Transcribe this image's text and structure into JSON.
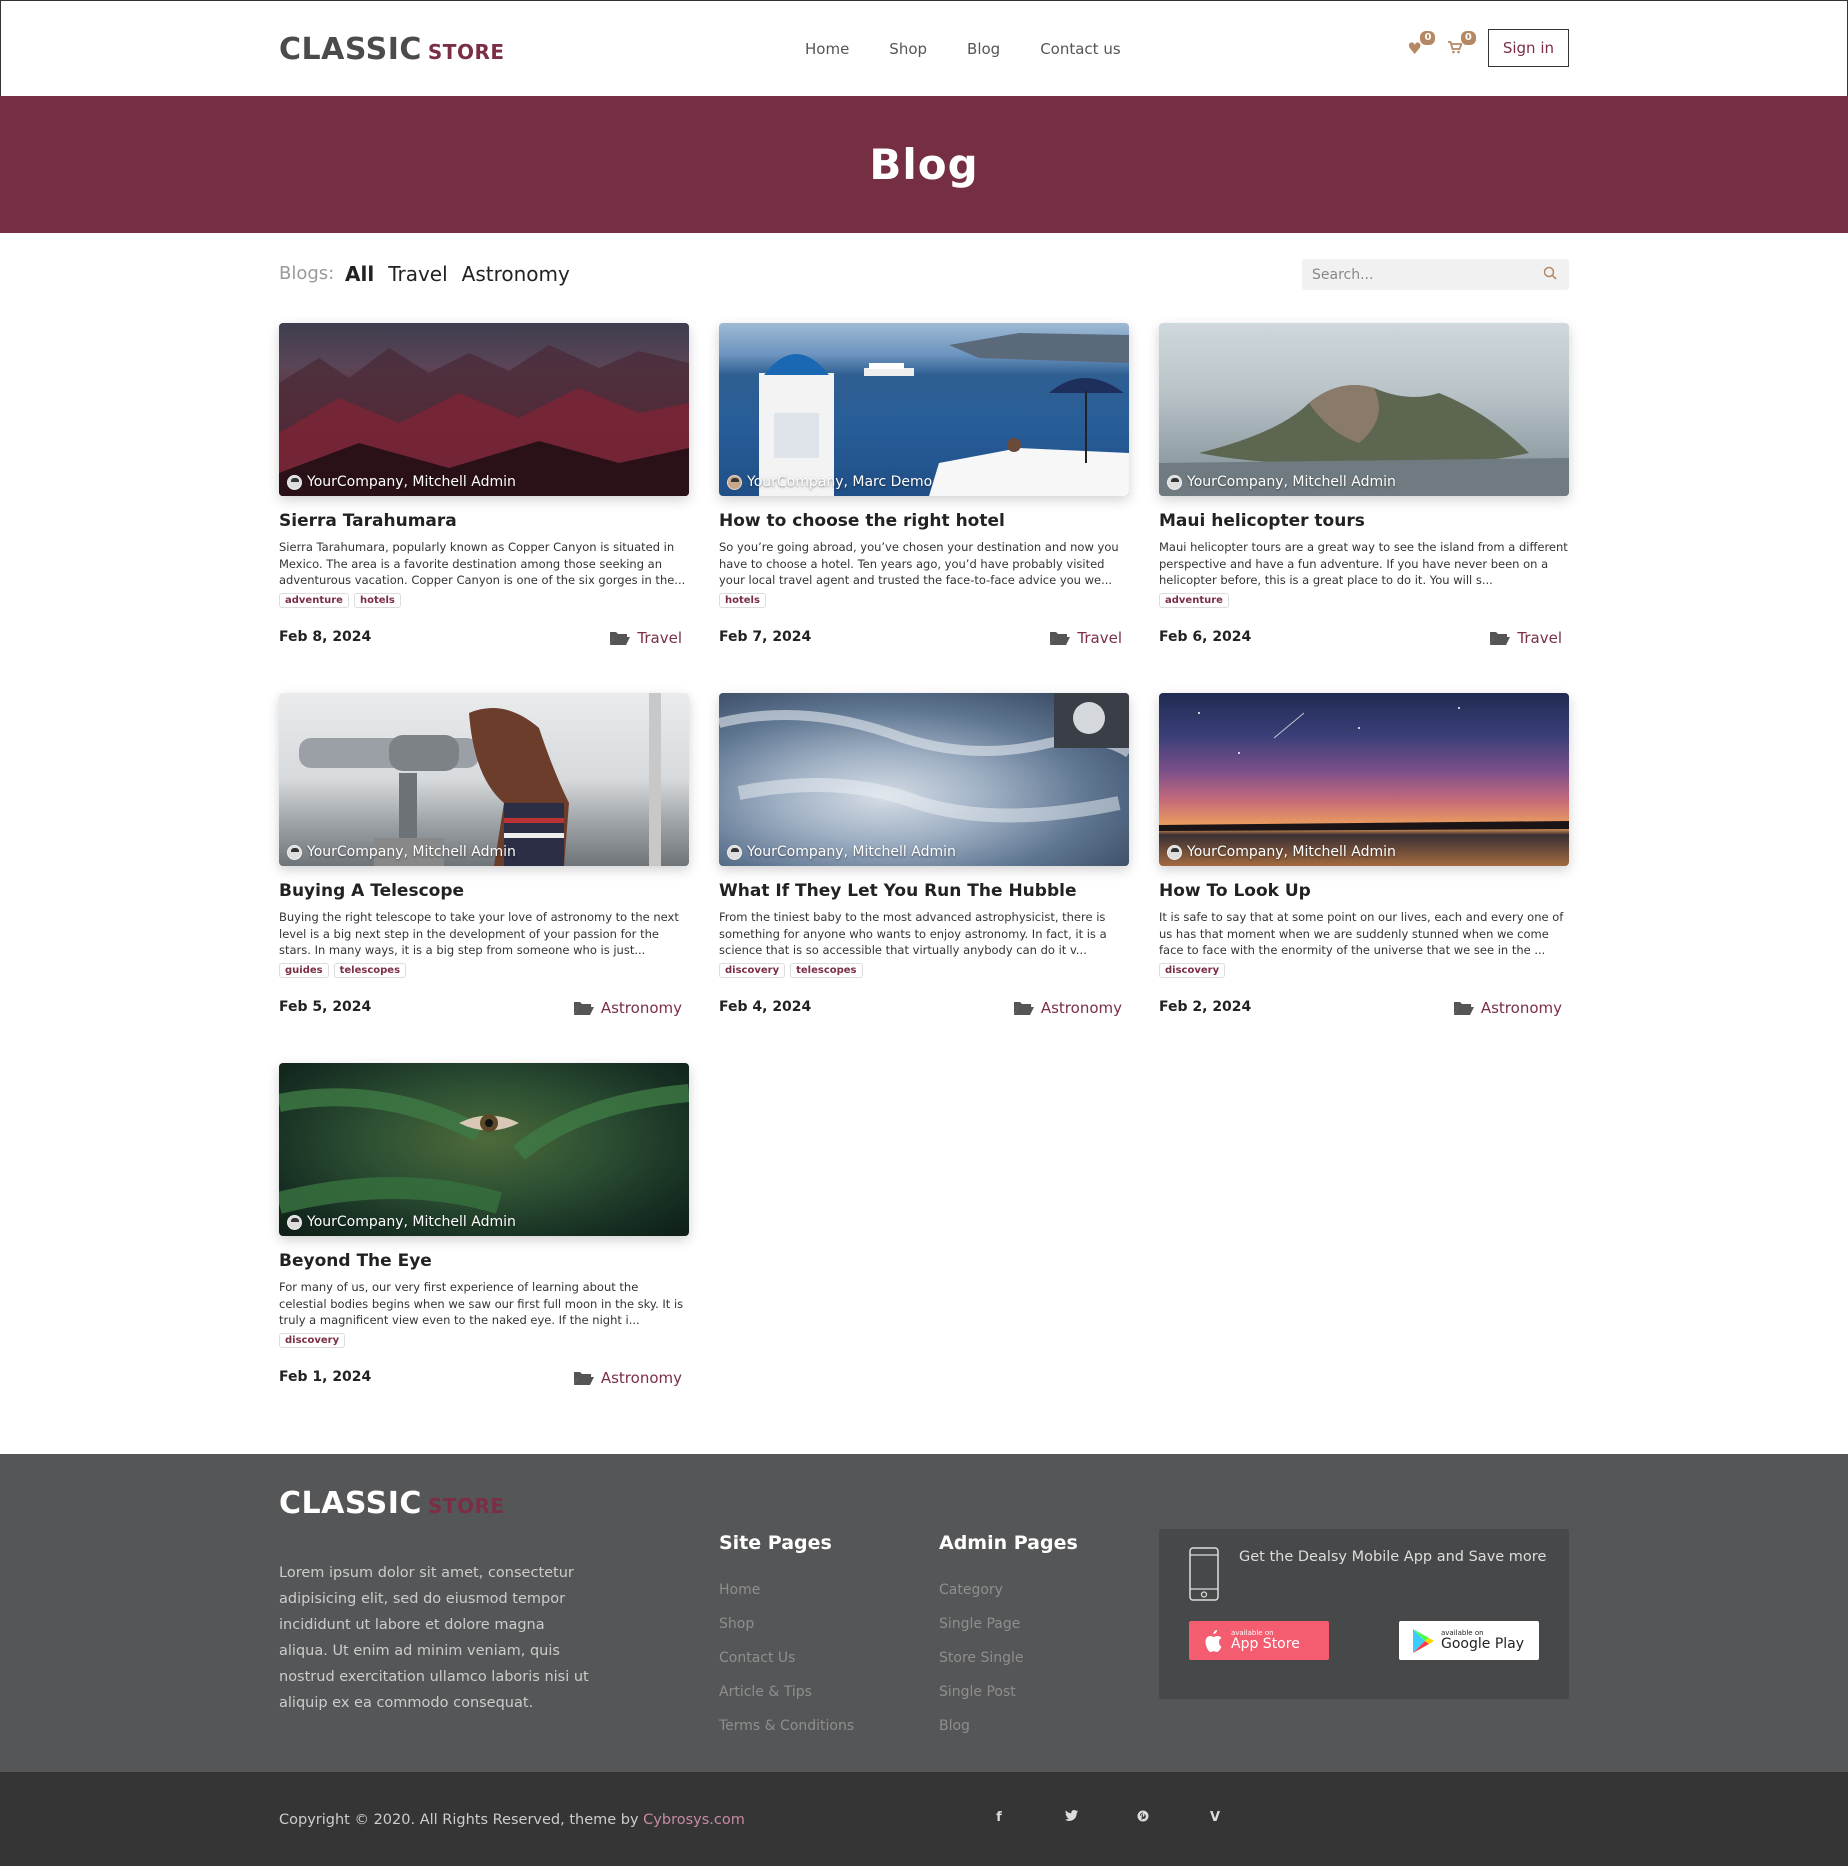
{
  "header": {
    "logo_main": "CLASSIC",
    "logo_sub": "STORE",
    "nav": [
      "Home",
      "Shop",
      "Blog",
      "Contact us"
    ],
    "wishlist_count": "0",
    "cart_count": "0",
    "signin_label": "Sign in"
  },
  "banner": {
    "title": "Blog"
  },
  "filter": {
    "label": "Blogs:",
    "options": [
      "All",
      "Travel",
      "Astronomy"
    ],
    "search_placeholder": "Search..."
  },
  "posts": [
    {
      "title": "Sierra Tarahumara",
      "author": "YourCompany, Mitchell Admin",
      "excerpt": "Sierra Tarahumara, popularly known as Copper Canyon is situated in Mexico. The area is a favorite destination among those seeking an adventurous vacation. Copper Canyon is one of the six gorges in the...",
      "tags": [
        "adventure",
        "hotels"
      ],
      "date": "Feb 8, 2024",
      "category": "Travel"
    },
    {
      "title": "How to choose the right hotel",
      "author": "YourCompany, Marc Demo",
      "excerpt": "So you’re going abroad, you’ve chosen your destination and now you have to choose a hotel. Ten years ago, you’d have probably visited your local travel agent and trusted the face-to-face advice you we...",
      "tags": [
        "hotels"
      ],
      "date": "Feb 7, 2024",
      "category": "Travel"
    },
    {
      "title": "Maui helicopter tours",
      "author": "YourCompany, Mitchell Admin",
      "excerpt": "Maui helicopter tours are a great way to see the island from a different perspective and have a fun adventure. If you have never been on a helicopter before, this is a great place to do it. You will s...",
      "tags": [
        "adventure"
      ],
      "date": "Feb 6, 2024",
      "category": "Travel"
    },
    {
      "title": "Buying A Telescope",
      "author": "YourCompany, Mitchell Admin",
      "excerpt": "Buying the right telescope to take your love of astronomy to the next level is a big next step in the development of your passion for the stars. In many ways, it is a big step from someone who is just...",
      "tags": [
        "guides",
        "telescopes"
      ],
      "date": "Feb 5, 2024",
      "category": "Astronomy"
    },
    {
      "title": "What If They Let You Run The Hubble",
      "author": "YourCompany, Mitchell Admin",
      "excerpt": "From the tiniest baby to the most advanced astrophysicist, there is something for anyone who wants to enjoy astronomy. In fact, it is a science that is so accessible that virtually anybody can do it v...",
      "tags": [
        "discovery",
        "telescopes"
      ],
      "date": "Feb 4, 2024",
      "category": "Astronomy"
    },
    {
      "title": "How To Look Up",
      "author": "YourCompany, Mitchell Admin",
      "excerpt": "It is safe to say that at some point on our lives, each and every one of us has that moment when we are suddenly stunned when we come face to face with the enormity of the universe that we see in the ...",
      "tags": [
        "discovery"
      ],
      "date": "Feb 2, 2024",
      "category": "Astronomy"
    },
    {
      "title": "Beyond The Eye",
      "author": "YourCompany, Mitchell Admin",
      "excerpt": "For many of us, our very first experience of learning about the celestial bodies begins when we saw our first full moon in the sky. It is truly a magnificent view even to the naked eye. If the night i...",
      "tags": [
        "discovery"
      ],
      "date": "Feb 1, 2024",
      "category": "Astronomy"
    }
  ],
  "footer": {
    "logo_main": "CLASSIC",
    "logo_sub": "STORE",
    "about": "Lorem ipsum dolor sit amet, consectetur adipisicing elit, sed do eiusmod tempor incididunt ut labore et dolore magna aliqua. Ut enim ad minim veniam, quis nostrud exercitation ullamco laboris nisi ut aliquip ex ea commodo consequat.",
    "site_pages_title": "Site Pages",
    "site_pages": [
      "Home",
      "Shop",
      "Contact Us",
      "Article & Tips",
      "Terms & Conditions"
    ],
    "admin_pages_title": "Admin Pages",
    "admin_pages": [
      "Category",
      "Single Page",
      "Store Single",
      "Single Post",
      "Blog"
    ],
    "app_text": "Get the Dealsy Mobile App and Save more",
    "apple_small": "available on",
    "apple_large": "App Store",
    "google_small": "available on",
    "google_large": "Google Play"
  },
  "bottom": {
    "copyright": "Copyright © 2020. All Rights Reserved, theme by ",
    "link": "Cybrosys.com",
    "social": [
      "facebook-icon",
      "twitter-icon",
      "pinterest-icon",
      "vimeo-icon"
    ]
  },
  "colors": {
    "brand": "#762f42",
    "accent": "#b58863",
    "footer": "#555657",
    "bottom": "#353536"
  }
}
